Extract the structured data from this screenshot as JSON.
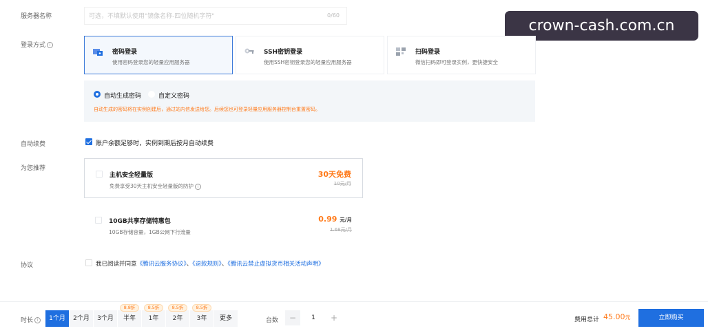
{
  "form": {
    "server_name_label": "服务器名称",
    "server_name_placeholder": "可选，不填默认使用\"镜像名称-四位随机字符\"",
    "server_name_count": "0/60",
    "login_label": "登录方式",
    "login_options": [
      {
        "title": "密码登录",
        "desc": "使用密码登录您的轻量应用服务器"
      },
      {
        "title": "SSH密钥登录",
        "desc": "使用SSH密钥登录您的轻量应用服务器"
      },
      {
        "title": "扫码登录",
        "desc": "微信扫码即可登录实例，更快捷安全"
      }
    ],
    "password_modes": [
      "自动生成密码",
      "自定义密码"
    ],
    "password_notice": "自动生成的密码将在实例创建后，通过站内信发送给您。后续您也可登录轻量应用服务器控制台重置密码。",
    "auto_renew_label": "自动续费",
    "auto_renew_text": "账户余额足够时，实例到期后按月自动续费",
    "recommend_label": "为您推荐",
    "recommend": [
      {
        "title": "主机安全轻量版",
        "desc": "免费享受30天主机安全轻量版的防护",
        "price": "30天免费",
        "orig": "10元/月"
      },
      {
        "title": "10GB共享存储特惠包",
        "desc": "10GB存储容量，1GB公网下行流量",
        "price": "0.99",
        "unit": "元/月",
        "orig": "1.68元/月"
      }
    ],
    "agreement_label": "协议",
    "agreement_prefix": "我已阅读并同意",
    "agreement_links": [
      "《腾讯云服务协议》",
      "《退款规则》",
      "《腾讯云禁止虚拟货币相关活动声明》"
    ],
    "agreement_sep": "、"
  },
  "watermark": "crown-cash.com.cn",
  "bottom": {
    "duration_label": "时长",
    "durations": [
      "1个月",
      "2个月",
      "3个月",
      "半年",
      "1年",
      "2年",
      "3年",
      "更多"
    ],
    "discounts": [
      "8.8折",
      "8.5折",
      "8.5折",
      "8.5折"
    ],
    "qty_label": "台数",
    "qty_minus": "−",
    "qty_value": "1",
    "qty_plus": "+",
    "total_label": "费用总计",
    "total_value": "45.00",
    "total_unit": "元",
    "buy_label": "立即购买"
  },
  "colors": {
    "accent": "#1f6fe0",
    "price": "#ff7a1a",
    "watermark_bg": "#3b3545"
  },
  "icons": [
    "info-icon",
    "password-icon",
    "key-icon",
    "qrcode-icon",
    "check-icon"
  ]
}
